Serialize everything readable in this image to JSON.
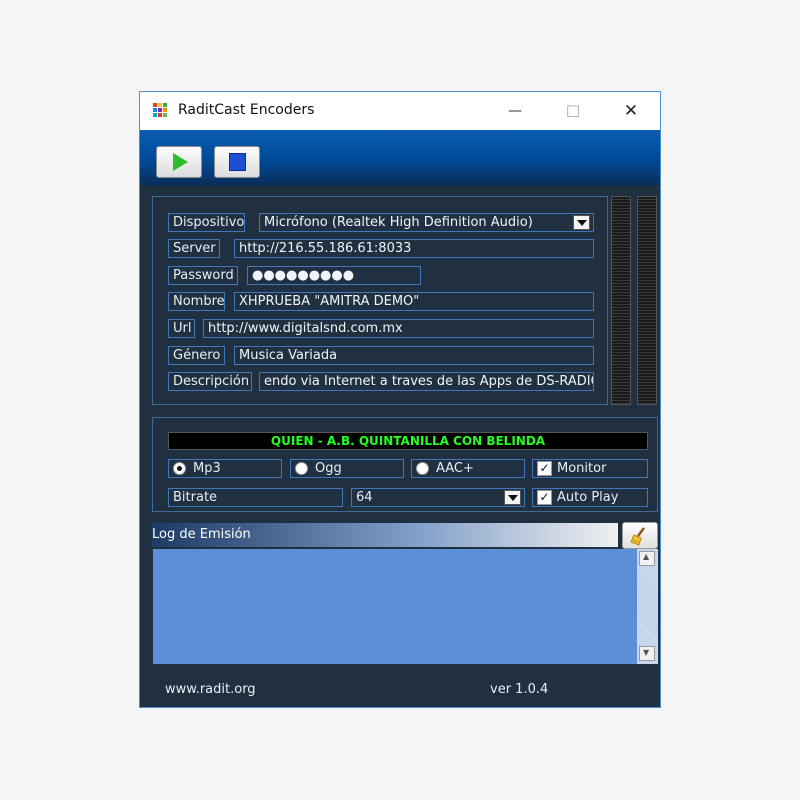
{
  "window": {
    "title": "RaditCast Encoders",
    "minimize": "—",
    "maximize": "☐",
    "close": "✕"
  },
  "form": {
    "dispositivo": {
      "label": "Dispositivo",
      "value": "Micrófono (Realtek High Definition Audio)"
    },
    "server": {
      "label": "Server",
      "value": "http://216.55.186.61:8033"
    },
    "password": {
      "label": "Password",
      "value": "●●●●●●●●●"
    },
    "nombre": {
      "label": "Nombre",
      "value": "XHPRUEBA \"AMITRA DEMO\""
    },
    "url": {
      "label": "Url",
      "value": "http://www.digitalsnd.com.mx"
    },
    "genero": {
      "label": "Género",
      "value": "Musica Variada"
    },
    "descripcion": {
      "label": "Descripción",
      "value": "endo via Internet a traves de las Apps de DS-RADIO"
    }
  },
  "now_playing": "QUIEN - A.B. QUINTANILLA CON BELINDA",
  "format": {
    "options": [
      {
        "label": "Mp3",
        "selected": true
      },
      {
        "label": "Ogg",
        "selected": false
      },
      {
        "label": "AAC+",
        "selected": false
      }
    ],
    "monitor": {
      "label": "Monitor",
      "checked": true,
      "mark": "✓"
    },
    "autoplay": {
      "label": "Auto Play",
      "checked": true,
      "mark": "✓"
    },
    "bitrate_label": "Bitrate",
    "bitrate_value": "64"
  },
  "log": {
    "title": "Log de Emisión",
    "scroll_up": "▲",
    "scroll_down": "▼"
  },
  "footer": {
    "website": "www.radit.org",
    "version": "ver 1.0.4"
  },
  "colors": {
    "accent": "#004a98",
    "panel": "#203040",
    "now_playing_text": "#22ff22",
    "log_area": "#5b8fd6"
  }
}
